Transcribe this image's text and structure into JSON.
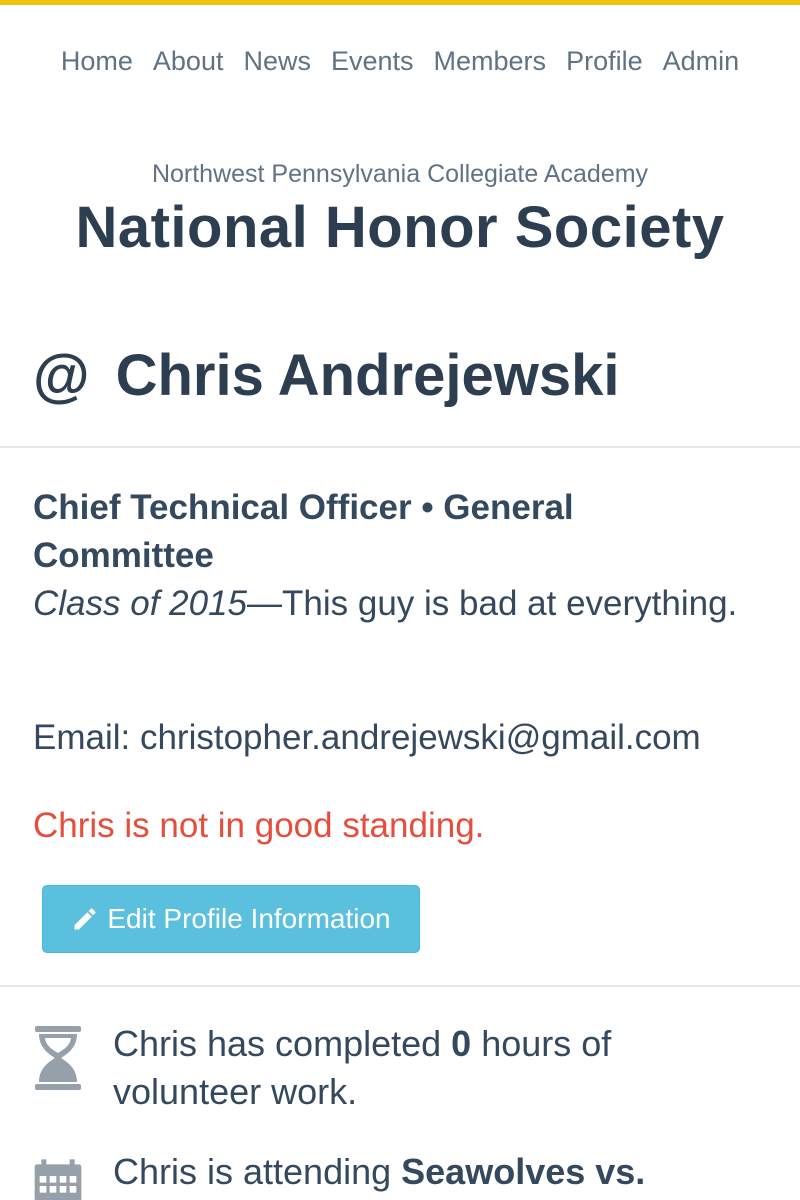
{
  "nav": {
    "items": [
      {
        "label": "Home"
      },
      {
        "label": "About"
      },
      {
        "label": "News"
      },
      {
        "label": "Events"
      },
      {
        "label": "Members"
      },
      {
        "label": "Profile"
      },
      {
        "label": "Admin"
      }
    ]
  },
  "header": {
    "school": "Northwest Pennsylvania Collegiate Academy",
    "organization": "National Honor Society"
  },
  "member": {
    "at_symbol": "@",
    "name": "Chris Andrejewski",
    "role_line_1": "Chief Technical Officer • General",
    "role_line_2": "Committee",
    "class_year": "Class of 2015",
    "bio": "—This guy is bad at everything.",
    "email": "Email: christopher.andrejewski@gmail.com",
    "standing": "Chris is not in good standing.",
    "edit_button_label": "Edit Profile Information"
  },
  "stats": {
    "hours_prefix": "Chris has completed ",
    "hours_value": "0",
    "hours_suffix": " hours of volunteer work.",
    "attending_prefix": "Chris is attending ",
    "attending_event": "Seawolves vs."
  },
  "colors": {
    "accent_bar": "#f1c40f",
    "text": "#34495e",
    "danger": "#e74c3c",
    "info_button": "#5bc0de"
  },
  "icons": {
    "edit": "pencil-icon",
    "hours": "hourglass-icon",
    "attending": "calendar-icon"
  }
}
